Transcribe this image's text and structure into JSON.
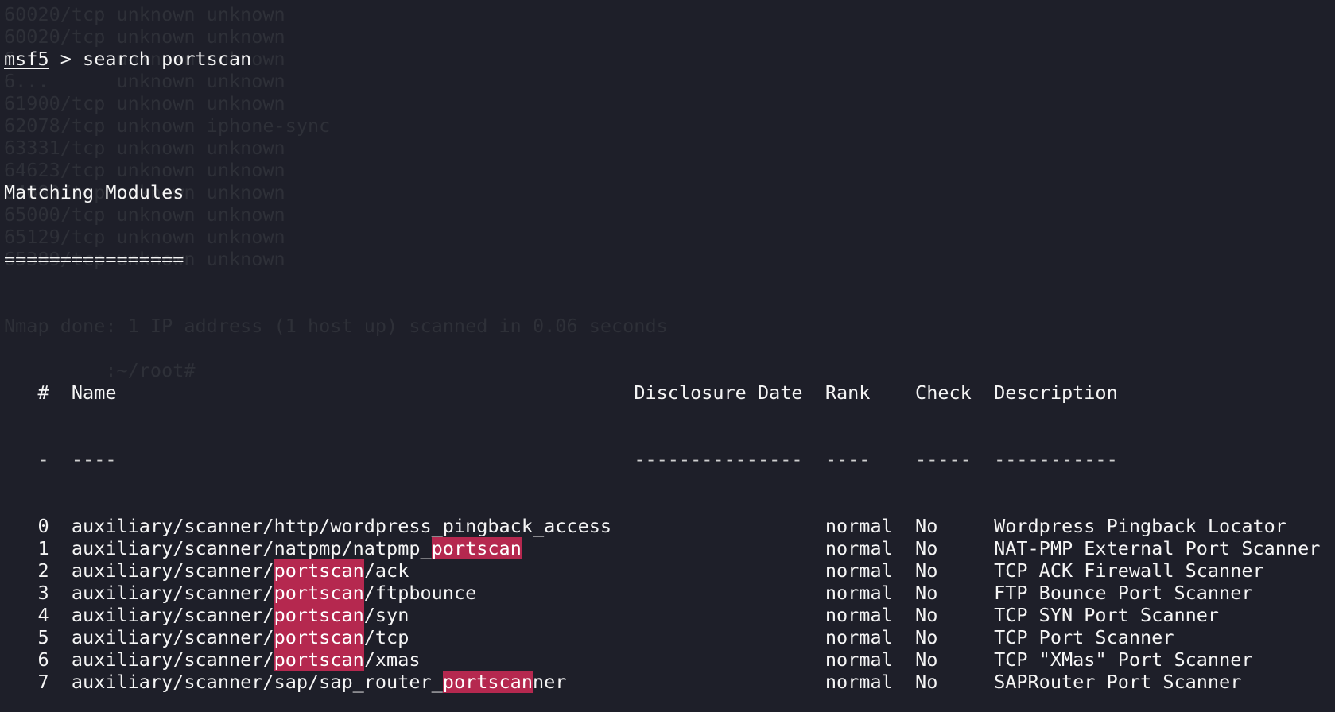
{
  "terminal": {
    "prompt_user": "msf5",
    "prompt_sep": " > ",
    "command": "search portscan",
    "heading": "Matching Modules",
    "heading_rule": "================",
    "headers": {
      "num": "#",
      "name": "Name",
      "date": "Disclosure Date",
      "rank": "Rank",
      "check": "Check",
      "desc": "Description"
    },
    "rules": {
      "num": "-",
      "name": "----",
      "date": "---------------",
      "rank": "----",
      "check": "-----",
      "desc": "-----------"
    },
    "highlight_color": "#b5284f",
    "background_color": "#1e1f29",
    "rows": [
      {
        "num": "0",
        "name_pre": "auxiliary/scanner/http/wordpress_pingback_access",
        "name_hl": "",
        "name_post": "",
        "date": "",
        "rank": "normal",
        "check": "No",
        "desc": "Wordpress Pingback Locator"
      },
      {
        "num": "1",
        "name_pre": "auxiliary/scanner/natpmp/natpmp_",
        "name_hl": "portscan",
        "name_post": "",
        "date": "",
        "rank": "normal",
        "check": "No",
        "desc": "NAT-PMP External Port Scanner"
      },
      {
        "num": "2",
        "name_pre": "auxiliary/scanner/",
        "name_hl": "portscan",
        "name_post": "/ack",
        "date": "",
        "rank": "normal",
        "check": "No",
        "desc": "TCP ACK Firewall Scanner"
      },
      {
        "num": "3",
        "name_pre": "auxiliary/scanner/",
        "name_hl": "portscan",
        "name_post": "/ftpbounce",
        "date": "",
        "rank": "normal",
        "check": "No",
        "desc": "FTP Bounce Port Scanner"
      },
      {
        "num": "4",
        "name_pre": "auxiliary/scanner/",
        "name_hl": "portscan",
        "name_post": "/syn",
        "date": "",
        "rank": "normal",
        "check": "No",
        "desc": "TCP SYN Port Scanner"
      },
      {
        "num": "5",
        "name_pre": "auxiliary/scanner/",
        "name_hl": "portscan",
        "name_post": "/tcp",
        "date": "",
        "rank": "normal",
        "check": "No",
        "desc": "TCP Port Scanner"
      },
      {
        "num": "6",
        "name_pre": "auxiliary/scanner/",
        "name_hl": "portscan",
        "name_post": "/xmas",
        "date": "",
        "rank": "normal",
        "check": "No",
        "desc": "TCP \"XMas\" Port Scanner"
      },
      {
        "num": "7",
        "name_pre": "auxiliary/scanner/sap/sap_router_",
        "name_hl": "portscan",
        "name_post": "ner",
        "date": "",
        "rank": "normal",
        "check": "No",
        "desc": "SAPRouter Port Scanner"
      }
    ],
    "ghost_lines": [
      "60020/tcp unknown unknown",
      "60020/tcp unknown unknown",
      "6...      unknown unknown",
      "6...      unknown unknown",
      "61900/tcp unknown unknown",
      "62078/tcp unknown iphone-sync",
      "63331/tcp unknown unknown",
      "64623/tcp unknown unknown",
      "64680/tcp unknown unknown",
      "65000/tcp unknown unknown",
      "65129/tcp unknown unknown",
      "65389/tcp unknown unknown",
      "",
      "",
      "Nmap done: 1 IP address (1 host up) scanned in 0.06 seconds",
      "",
      "         :~/root#"
    ]
  }
}
